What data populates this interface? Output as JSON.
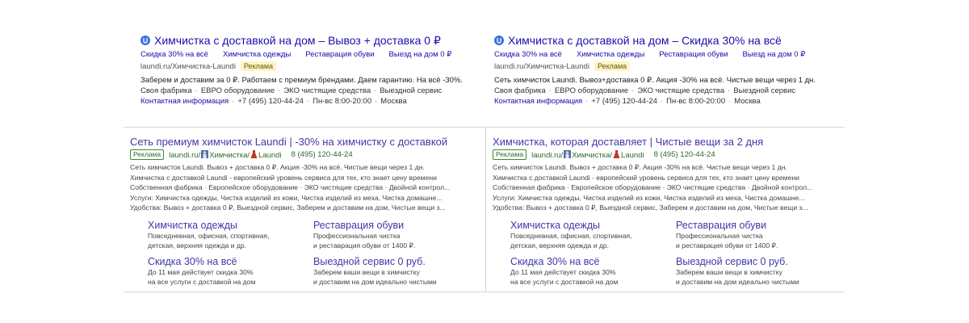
{
  "google_ads": [
    {
      "title": "Химчистка с доставкой на дом – Вывоз + доставка 0 ₽",
      "sitelinks": [
        "Скидка 30% на всё",
        "Химчистка одежды",
        "Реставрация обуви",
        "Выезд на дом 0 ₽"
      ],
      "url": "laundi.ru/Химчистка-Laundi",
      "badge": "Реклама",
      "text": "Заберем и доставим за 0 ₽. Работаем с премиум брендами. Даем гарантию. На всё -30%.",
      "features": [
        "Своя фабрика",
        "ЕВРО оборудование",
        "ЭКО чистящие средства",
        "Выездной сервис"
      ],
      "contact_link": "Контактная информация",
      "phone": "+7 (495) 120-44-24",
      "hours": "Пн-вс 8:00-20:00",
      "city": "Москва"
    },
    {
      "title": "Химчистка с доставкой на дом – Скидка 30% на всё",
      "sitelinks": [
        "Скидка 30% на всё",
        "Химчистка одежды",
        "Реставрация обуви",
        "Выезд на дом 0 ₽"
      ],
      "url": "laundi.ru/Химчистка-Laundi",
      "badge": "Реклама",
      "text": "Сеть химчисток Laundi. Вывоз+доставка 0 ₽. Акция -30% на всё. Чистые вещи через 1 дн.",
      "features": [
        "Своя фабрика",
        "ЕВРО оборудование",
        "ЭКО чистящие средства",
        "Выездной сервис"
      ],
      "contact_link": "Контактная информация",
      "phone": "+7 (495) 120-44-24",
      "hours": "Пн-вс 8:00-20:00",
      "city": "Москва"
    }
  ],
  "yandex_ads": [
    {
      "title": "Сеть премиум химчисток Laundi | -30% на химчистку с доставкой",
      "badge": "Реклама",
      "url_a": "laundi.ru/",
      "url_b": "Химчистка/",
      "url_c": "Laundi",
      "phone": "8 (495) 120-44-24",
      "desc": [
        "Сеть химчисток Laundi. Вывоз + доставка 0 ₽. Акция -30% на всё. Чистые вещи через 1 дн.",
        "Химчистка с доставкой Laundi - европейский уровень сервиса для тех, кто знает цену времени",
        "Собственная фабрика · Европейское оборудование · ЭКО чистящие средства · Двойной контрол...",
        "Услуги: Химчистка одежды, Чистка изделий из кожи, Чистка изделий из меха, Чистка домашне...",
        "Удобства: Вывоз + доставка 0 ₽, Выездной сервис, Заберем и доставим на дом, Чистые вещи з..."
      ],
      "links": [
        {
          "title": "Химчистка одежды",
          "desc1": "Повседневная, офисная, спортивная,",
          "desc2": "детская, верхняя одежда и др."
        },
        {
          "title": "Реставрация обуви",
          "desc1": "Профессиональная чистка",
          "desc2": "и реставрация обуви от 1400 ₽."
        },
        {
          "title": "Скидка 30% на всё",
          "desc1": "До 11 мая действует скидка 30%",
          "desc2": "на все услуги с доставкой на дом"
        },
        {
          "title": "Выездной сервис 0 руб.",
          "desc1": "Заберем ваши вещи в химчистку",
          "desc2": "и доставим на дом идеально чистыми"
        }
      ]
    },
    {
      "title": "Химчистка, которая доставляет | Чистые вещи за 2 дня",
      "badge": "Реклама",
      "url_a": "laundi.ru/",
      "url_b": "Химчистка/",
      "url_c": "Laundi",
      "phone": "8 (495) 120-44-24",
      "desc": [
        "Сеть химчисток Laundi. Вывоз + доставка 0 ₽. Акция -30% на всё. Чистые вещи через 1 дн.",
        "Химчистка с доставкой Laundi - европейский уровень сервиса для тех, кто знает цену времени",
        "Собственная фабрика · Европейское оборудование · ЭКО чистящие средства · Двойной контрол...",
        "Услуги: Химчистка одежды, Чистка изделий из кожи, Чистка изделий из меха, Чистка домашне...",
        "Удобства: Вывоз + доставка 0 ₽, Выездной сервис, Заберем и доставим на дом, Чистые вещи з..."
      ],
      "links": [
        {
          "title": "Химчистка одежды",
          "desc1": "Повседневная, офисная, спортивная,",
          "desc2": "детская, верхняя одежда и др."
        },
        {
          "title": "Реставрация обуви",
          "desc1": "Профессиональная чистка",
          "desc2": "и реставрация обуви от 1400 ₽."
        },
        {
          "title": "Скидка 30% на всё",
          "desc1": "До 11 мая действует скидка 30%",
          "desc2": "на все услуги с доставкой на дом"
        },
        {
          "title": "Выездной сервис 0 руб.",
          "desc1": "Заберем ваши вещи в химчистку",
          "desc2": "и доставим на дом идеально чистыми"
        }
      ]
    }
  ],
  "colors": {
    "google_link": "#1a0dab",
    "yandex_link": "#3f3aa8",
    "yandex_url": "#2a6b2a",
    "badge_bg": "#fff3c6"
  },
  "icons": {
    "google_favicon": "laundi-favicon-icon",
    "url_person": "person-icon",
    "url_dress": "dress-icon"
  }
}
